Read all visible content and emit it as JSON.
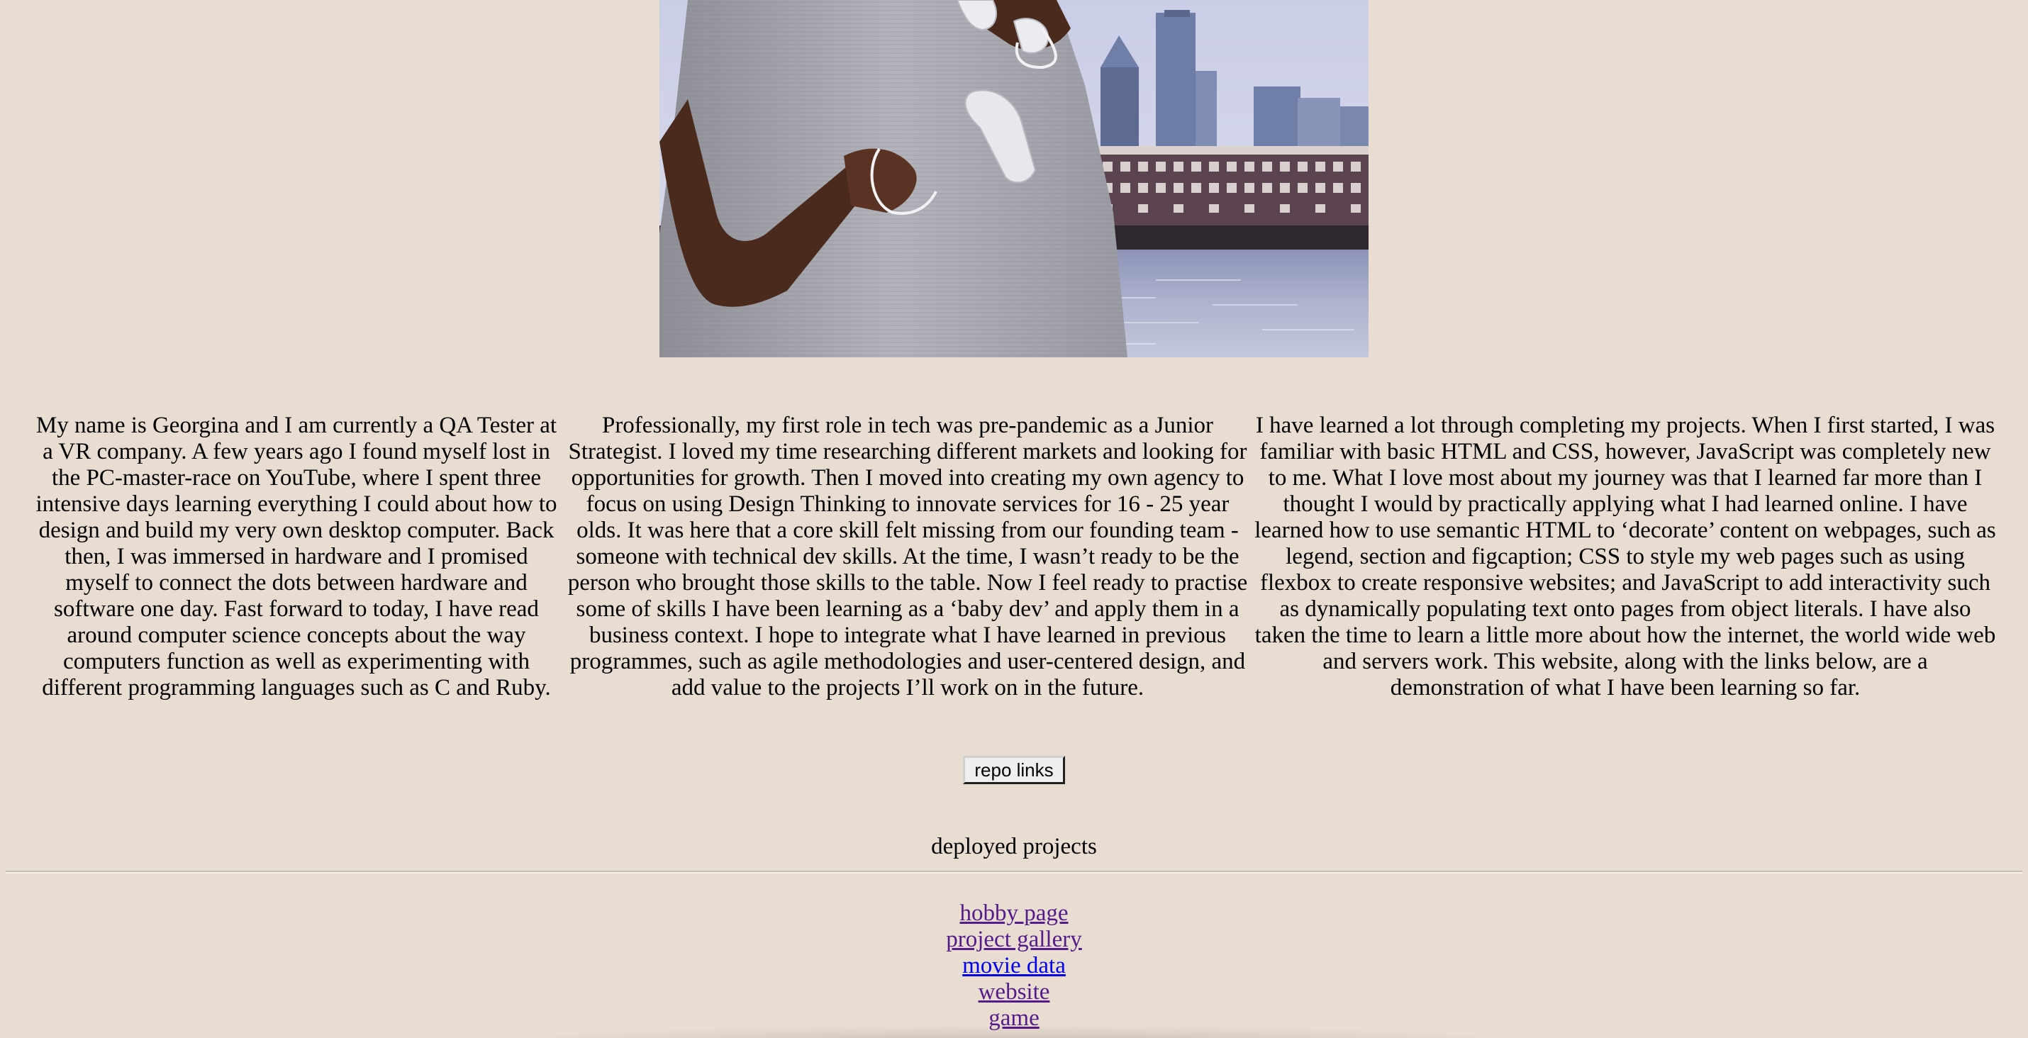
{
  "hero": {
    "icon": "profile-photo"
  },
  "bio": {
    "col1": "My name is Georgina and I am currently a QA Tester at a VR company. A few years ago I found myself lost in the PC-master-race on YouTube, where I spent three intensive days learning everything I could about how to design and build my very own desktop computer. Back then, I was immersed in hardware and I promised myself to connect the dots between hardware and software one day. Fast forward to today, I have read around computer science concepts about the way computers function as well as experimenting with different programming languages such as C and Ruby.",
    "col2": "Professionally, my first role in tech was pre-pandemic as a Junior Strategist. I loved my time researching different markets and looking for opportunities for growth. Then I moved into creating my own agency to focus on using Design Thinking to innovate services for 16 - 25 year olds. It was here that a core skill felt missing from our founding team - someone with technical dev skills. At the time, I wasn’t ready to be the person who brought those skills to the table. Now I feel ready to practise some of skills I have been learning as a ‘baby dev’ and apply them in a business context. I hope to integrate what I have learned in previous programmes, such as agile methodologies and user-centered design, and add value to the projects I’ll work on in the future.",
    "col3": "I have learned a lot through completing my projects. When I first started, I was familiar with basic HTML and CSS, however, JavaScript was completely new to me. What I love most about my journey was that I learned far more than I thought I would by practically applying what I had learned online. I have learned how to use semantic HTML to ‘decorate’ content on webpages, such as legend, section and figcaption; CSS to style my web pages such as using flexbox to create responsive websites; and JavaScript to add interactivity such as dynamically populating text onto pages from object literals. I have also taken the time to learn a little more about how the internet, the world wide web and servers work. This website, along with the links below, are a demonstration of what I have been learning so far."
  },
  "repo_button": {
    "label": "repo links"
  },
  "deployed": {
    "heading": "deployed projects",
    "links": [
      {
        "label": "hobby page",
        "state": "visited"
      },
      {
        "label": "project gallery",
        "state": "visited"
      },
      {
        "label": "movie data",
        "state": "unvisited"
      },
      {
        "label": "website",
        "state": "visited"
      },
      {
        "label": "game",
        "state": "visited"
      }
    ]
  },
  "colors": {
    "page_background": "#e8ddd0",
    "link_visited": "#551a8b",
    "link_unvisited": "#0000ee"
  }
}
